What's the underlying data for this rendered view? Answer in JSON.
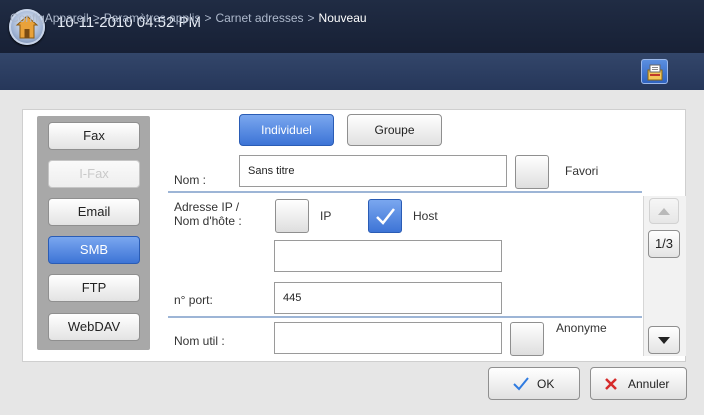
{
  "status": {
    "datetime": "10-11-2010 04:52 PM"
  },
  "breadcrumb": {
    "items": [
      "ConfigAppareil",
      "Paramètres applis",
      "Carnet adresses",
      "Nouveau"
    ],
    "separator": ">"
  },
  "types": {
    "items": [
      {
        "label": "Fax",
        "state": "normal"
      },
      {
        "label": "I-Fax",
        "state": "disabled"
      },
      {
        "label": "Email",
        "state": "normal"
      },
      {
        "label": "SMB",
        "state": "selected"
      },
      {
        "label": "FTP",
        "state": "normal"
      },
      {
        "label": "WebDAV",
        "state": "normal"
      }
    ]
  },
  "mode": {
    "individual_label": "Individuel",
    "group_label": "Groupe",
    "selected": "Individuel"
  },
  "form": {
    "name_label": "Nom :",
    "name_value": "Sans titre",
    "favorite_label": "Favori",
    "favorite_checked": false,
    "address_label_line1": "Adresse IP /",
    "address_label_line2": "Nom d'hôte :",
    "ip_label": "IP",
    "ip_checked": false,
    "host_label": "Host",
    "host_checked": true,
    "host_value": "",
    "port_label": "n° port:",
    "port_value": "445",
    "user_label": "Nom util :",
    "user_value": "",
    "anonymous_label": "Anonyme",
    "anonymous_checked": false
  },
  "pager": {
    "indicator": "1/3"
  },
  "actions": {
    "ok_label": "OK",
    "cancel_label": "Annuler"
  },
  "colors": {
    "accent": "#3d74d6",
    "topbar": "#1a2339",
    "crumbbar": "#2c3f63",
    "cancel_x": "#d62b2b",
    "ok_check": "#2f7be0"
  }
}
